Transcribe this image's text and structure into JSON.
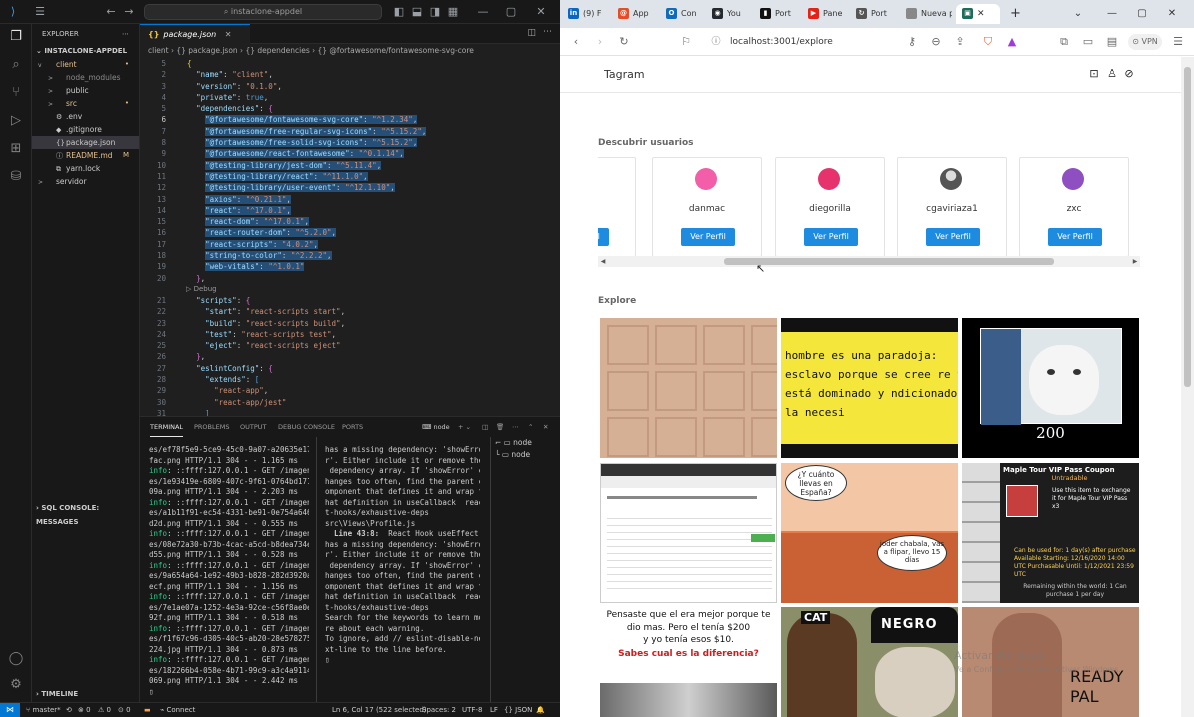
{
  "vscode": {
    "search_text": "instaclone-appdel",
    "explorer_header": "EXPLORER",
    "project_name": "INSTACLONE-APPDEL",
    "tree": [
      {
        "label": "client",
        "indent": 0,
        "twisty": "v",
        "icon": "",
        "badge": "•",
        "cls": "c-mod"
      },
      {
        "label": "node_modules",
        "indent": 1,
        "twisty": ">",
        "icon": "",
        "badge": "",
        "cls": "c-dim"
      },
      {
        "label": "public",
        "indent": 1,
        "twisty": ">",
        "icon": "",
        "badge": "",
        "cls": ""
      },
      {
        "label": "src",
        "indent": 1,
        "twisty": ">",
        "icon": "",
        "badge": "•",
        "cls": "c-mod"
      },
      {
        "label": ".env",
        "indent": 1,
        "twisty": "",
        "icon": "⚙",
        "badge": "",
        "cls": ""
      },
      {
        "label": ".gitignore",
        "indent": 1,
        "twisty": "",
        "icon": "◆",
        "badge": "",
        "cls": ""
      },
      {
        "label": "package.json",
        "indent": 1,
        "twisty": "",
        "icon": "{}",
        "badge": "",
        "cls": "",
        "selected": true
      },
      {
        "label": "README.md",
        "indent": 1,
        "twisty": "",
        "icon": "ⓘ",
        "badge": "M",
        "cls": "c-mod"
      },
      {
        "label": "yarn.lock",
        "indent": 1,
        "twisty": "",
        "icon": "⧉",
        "badge": "",
        "cls": ""
      },
      {
        "label": "servidor",
        "indent": 0,
        "twisty": ">",
        "icon": "",
        "badge": "",
        "cls": ""
      }
    ],
    "sql_console": "SQL CONSOLE: MESSAGES",
    "timeline": "TIMELINE",
    "tab_label": "package.json",
    "breadcrumb": "client › {} package.json › {} dependencies › {} @fortawesome/fontawesome-svg-core",
    "code_lines": [
      {
        "n": "5",
        "html": "  <span class=\"p\">{</span>"
      },
      {
        "n": "2",
        "html": "    <span class=\"key\">\"name\"</span>: <span class=\"k\">\"client\"</span>,"
      },
      {
        "n": "3",
        "html": "    <span class=\"key\">\"version\"</span>: <span class=\"k\">\"0.1.0\"</span>,"
      },
      {
        "n": "4",
        "html": "    <span class=\"key\">\"private\"</span>: <span class=\"lit\">true</span>,"
      },
      {
        "n": "5",
        "html": "    <span class=\"key\">\"dependencies\"</span>: <span class=\"pb\">{</span>"
      },
      {
        "n": "6",
        "html": "      <span class=\"cc\"><span class=\"key\">\"@fortawesome/fontawesome-svg-core\"</span>: <span class=\"k\">\"^1.2.34\"</span>,</span>",
        "cur": true,
        "hl": true
      },
      {
        "n": "7",
        "html": "      <span class=\"cc\"><span class=\"key\">\"@fortawesome/free-regular-svg-icons\"</span>: <span class=\"k\">\"^5.15.2\"</span>,</span>",
        "hl": true
      },
      {
        "n": "8",
        "html": "      <span class=\"cc\"><span class=\"key\">\"@fortawesome/free-solid-svg-icons\"</span>: <span class=\"k\">\"^5.15.2\"</span>,</span>",
        "hl": true
      },
      {
        "n": "9",
        "html": "      <span class=\"cc\"><span class=\"key\">\"@fortawesome/react-fontawesome\"</span>: <span class=\"k\">\"^0.1.14\"</span>,</span>",
        "hl": true
      },
      {
        "n": "10",
        "html": "      <span class=\"cc\"><span class=\"key\">\"@testing-library/jest-dom\"</span>: <span class=\"k\">\"^5.11.4\"</span>,</span>",
        "hl": true
      },
      {
        "n": "11",
        "html": "      <span class=\"cc\"><span class=\"key\">\"@testing-library/react\"</span>: <span class=\"k\">\"^11.1.0\"</span>,</span>",
        "hl": true
      },
      {
        "n": "12",
        "html": "      <span class=\"cc\"><span class=\"key\">\"@testing-library/user-event\"</span>: <span class=\"k\">\"^12.1.10\"</span>,</span>",
        "hl": true
      },
      {
        "n": "13",
        "html": "      <span class=\"cc\"><span class=\"key\">\"axios\"</span>: <span class=\"k\">\"^0.21.1\"</span>,</span>",
        "hl": true
      },
      {
        "n": "14",
        "html": "      <span class=\"cc\"><span class=\"key\">\"react\"</span>: <span class=\"k\">\"^17.0.1\"</span>,</span>",
        "hl": true
      },
      {
        "n": "15",
        "html": "      <span class=\"cc\"><span class=\"key\">\"react-dom\"</span>: <span class=\"k\">\"^17.0.1\"</span>,</span>",
        "hl": true
      },
      {
        "n": "16",
        "html": "      <span class=\"cc\"><span class=\"key\">\"react-router-dom\"</span>: <span class=\"k\">\"^5.2.0\"</span>,</span>",
        "hl": true
      },
      {
        "n": "17",
        "html": "      <span class=\"cc\"><span class=\"key\">\"react-scripts\"</span>: <span class=\"k\">\"4.0.2\"</span>,</span>",
        "hl": true
      },
      {
        "n": "18",
        "html": "      <span class=\"cc\"><span class=\"key\">\"string-to-color\"</span>: <span class=\"k\">\"^2.2.2\"</span>,</span>",
        "hl": true
      },
      {
        "n": "19",
        "html": "      <span class=\"cc\"><span class=\"key\">\"web-vitals\"</span>: <span class=\"k\">\"^1.0.1\"</span></span>",
        "hl": true
      },
      {
        "n": "20",
        "html": "    <span class=\"pb\">}</span>,"
      },
      {
        "n": "",
        "html": "",
        "lens": "▷ Debug"
      },
      {
        "n": "21",
        "html": "    <span class=\"key\">\"scripts\"</span>: <span class=\"pb\">{</span>"
      },
      {
        "n": "22",
        "html": "      <span class=\"key\">\"start\"</span>: <span class=\"k\">\"react-scripts start\"</span>,"
      },
      {
        "n": "23",
        "html": "      <span class=\"key\">\"build\"</span>: <span class=\"k\">\"react-scripts build\"</span>,"
      },
      {
        "n": "24",
        "html": "      <span class=\"key\">\"test\"</span>: <span class=\"k\">\"react-scripts test\"</span>,"
      },
      {
        "n": "25",
        "html": "      <span class=\"key\">\"eject\"</span>: <span class=\"k\">\"react-scripts eject\"</span>"
      },
      {
        "n": "26",
        "html": "    <span class=\"pb\">}</span>,"
      },
      {
        "n": "27",
        "html": "    <span class=\"key\">\"eslintConfig\"</span>: <span class=\"pb\">{</span>"
      },
      {
        "n": "28",
        "html": "      <span class=\"key\">\"extends\"</span>: <span class=\"lit\">[</span>"
      },
      {
        "n": "29",
        "html": "        <span class=\"k\">\"react-app\"</span>,"
      },
      {
        "n": "30",
        "html": "        <span class=\"k\">\"react-app/jest\"</span>"
      },
      {
        "n": "31",
        "html": "      <span class=\"lit\">]</span>"
      }
    ],
    "panel_tabs": [
      "TERMINAL",
      "PROBLEMS",
      "OUTPUT",
      "DEBUG CONSOLE",
      "PORTS"
    ],
    "terminal_name": "node",
    "terminal_left": [
      "es/ef78f5e9-5ce9-45c0-9a07-a20635e17",
      "fac.png HTTP/1.1 304 - - 1.165 ms",
      "info: ::ffff:127.0.0.1 - GET /imagen",
      "es/1e93419e-6809-407c-9f61-0764bd171",
      "09a.png HTTP/1.1 304 - - 2.203 ms",
      "info: ::ffff:127.0.0.1 - GET /imagen",
      "es/a1b11f91-ec54-4331-be91-0e754a646",
      "d2d.png HTTP/1.1 304 - - 0.555 ms",
      "info: ::ffff:127.0.0.1 - GET /imagen",
      "es/08e72a30-b73b-4cac-a5cd-b8dea734e",
      "d55.png HTTP/1.1 304 - - 0.528 ms",
      "info: ::ffff:127.0.0.1 - GET /imagen",
      "es/9a654a64-1e92-49b3-b828-282d3920a",
      "ecf.png HTTP/1.1 304 - - 1.156 ms",
      "info: ::ffff:127.0.0.1 - GET /imagen",
      "es/7e1ae07a-1252-4e3a-92ce-c56f8ae0e",
      "92f.png HTTP/1.1 304 - - 0.518 ms",
      "info: ::ffff:127.0.0.1 - GET /imagen",
      "es/f1f67c96-d305-40c5-ab20-28e578275",
      "224.jpg HTTP/1.1 304 - - 0.873 ms",
      "info: ::ffff:127.0.0.1 - GET /imagen",
      "es/182266b4-058e-4b71-99c9-a3c4a9114",
      "069.png HTTP/1.1 304 - - 2.442 ms",
      "▯"
    ],
    "terminal_right": [
      "has a missing dependency: 'showErro",
      "r'. Either include it or remove the",
      " dependency array. If 'showError' c",
      "hanges too often, find the parent c",
      "omponent that defines it and wrap t",
      "hat definition in useCallback  reac",
      "t-hooks/exhaustive-deps",
      "",
      "src\\Views\\Profile.js",
      "  Line 43:8:  React Hook useEffect",
      "has a missing dependency: 'showErro",
      "r'. Either include it or remove the",
      " dependency array. If 'showError' c",
      "hanges too often, find the parent c",
      "omponent that defines it and wrap t",
      "hat definition in useCallback  reac",
      "t-hooks/exhaustive-deps",
      "",
      "Search for the keywords to learn mo",
      "re about each warning.",
      "To ignore, add // eslint-disable-ne",
      "xt-line to the line before.",
      "",
      "▯"
    ],
    "terminal_instances": [
      "node",
      "node"
    ],
    "status": {
      "branch": "master*",
      "sync": "⟲",
      "errors": "⊗ 0",
      "warnings": "⚠ 0",
      "ports": "⊙ 0",
      "connect": "Connect",
      "position": "Ln 6, Col 17 (522 selected)",
      "spaces": "Spaces: 2",
      "encoding": "UTF-8",
      "eol": "LF",
      "language": "{} JSON"
    }
  },
  "browser": {
    "tabs": [
      {
        "label": "(9) F",
        "fav": "in",
        "color": "#0a66c2"
      },
      {
        "label": "App",
        "fav": "@",
        "color": "#e44d26"
      },
      {
        "label": "Con",
        "fav": "O",
        "color": "#0f6cbd"
      },
      {
        "label": "You",
        "fav": "◉",
        "color": "#24292f"
      },
      {
        "label": "Port",
        "fav": "▮",
        "color": "#111"
      },
      {
        "label": "Pane",
        "fav": "▶",
        "color": "#e62117"
      },
      {
        "label": "Port",
        "fav": "↻",
        "color": "#555"
      },
      {
        "label": "Nueva p",
        "fav": "",
        "color": "#888"
      }
    ],
    "active_tab_fav": "▣",
    "url": "localhost:3001/explore",
    "vpn": "VPN",
    "brand": "Tagram",
    "discover_title": "Descubrir usuarios",
    "explore_title": "Explore",
    "view_profile": "Ver Perfil",
    "users": [
      {
        "name": "",
        "color": "#ffffff",
        "photo": false,
        "partial": true
      },
      {
        "name": "danmac",
        "color": "#f25ea8",
        "photo": false
      },
      {
        "name": "diegorilla",
        "color": "#e6336e",
        "photo": false
      },
      {
        "name": "cgaviriaza1",
        "color": "#888888",
        "photo": true
      },
      {
        "name": "zxc",
        "color": "#8e4fc0",
        "photo": false
      }
    ],
    "images": {
      "img2_text": "hombre es una paradoja: esclavo porque se cree re y está dominado y ndicionado por la necesi",
      "img3_caption": "200",
      "img5_bubble1": "¿Y cuánto llevas en España?",
      "img5_bubble2": "joder chabala, vas a flipar, llevo 15 días",
      "img6_title": "Maple Tour VIP Pass Coupon",
      "img6_sub": "Untradable",
      "img6_desc": "Use this item to exchange it for Maple Tour VIP Pass x3",
      "img6_info": "Can be used for: 1 day(s) after purchase Available Starting: 12/16/2020 14:00 UTC Purchasable Until: 1/12/2021 23:59 UTC",
      "img6_remaining": "Remaining within the world: 1 Can purchase 1 per day",
      "img7_line1": "Pensaste que el era mejor porque te dio mas. Pero el tenía $200",
      "img7_line2": "y yo tenía esos $10.",
      "img7_line3": "Sabes cual es la diferencia?",
      "img8_cap": "CAT",
      "img8_hat": "NEGRO",
      "img9_text": "READY PAL"
    },
    "watermark_title": "Activar Windows",
    "watermark_sub": "Ve a Configuración para activar Windows."
  }
}
